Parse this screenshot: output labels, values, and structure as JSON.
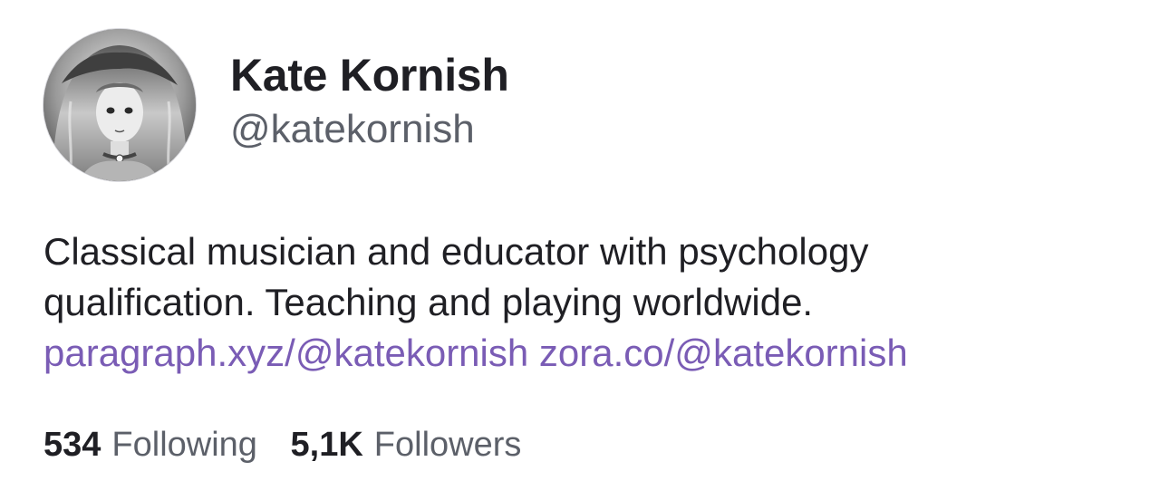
{
  "profile": {
    "display_name": "Kate Kornish",
    "handle": "@katekornish",
    "avatar": "avatar-illustrated-portrait"
  },
  "bio": {
    "line1": "Classical musician and educator with psychology",
    "line2": "qualification. Teaching and playing worldwide.",
    "links": [
      {
        "text": "paragraph.xyz/@katekornish"
      },
      {
        "text": "zora.co/@katekornish"
      }
    ]
  },
  "stats": {
    "following": {
      "count": "534",
      "label": "Following"
    },
    "followers": {
      "count": "5,1K",
      "label": "Followers"
    }
  },
  "colors": {
    "text": "#1f1f24",
    "muted": "#5c6069",
    "link": "#7a5cb5",
    "background": "#ffffff"
  }
}
